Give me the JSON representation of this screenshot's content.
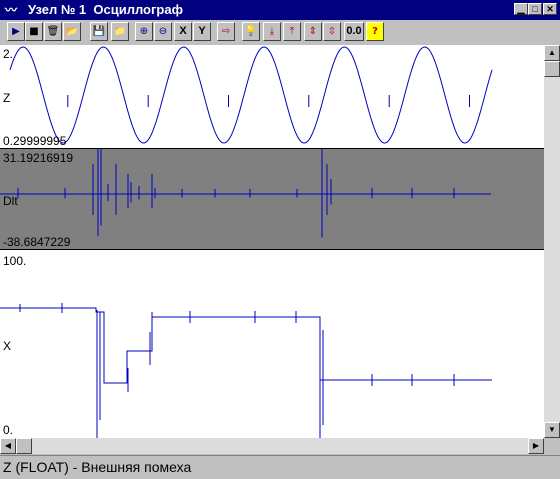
{
  "window": {
    "title": "Узел № 1  Осциллограф",
    "system_icon": "oscilloscope-icon",
    "controls": [
      "minimize-icon",
      "maximize-icon",
      "close-icon"
    ],
    "control_glyphs": [
      "▁",
      "□",
      "✕"
    ]
  },
  "toolbar": {
    "buttons": [
      {
        "name": "play-button",
        "icon": "play-icon",
        "glyph": "▶"
      },
      {
        "name": "stop-button",
        "icon": "stop-icon",
        "glyph": "■"
      },
      {
        "name": "delete-button",
        "icon": "trash-icon",
        "glyph": "🗑"
      },
      {
        "name": "open-folder-button",
        "icon": "folder-icon",
        "glyph": "📂"
      },
      {
        "name": "save-button",
        "icon": "floppy-icon",
        "glyph": "💾"
      },
      {
        "name": "open-button",
        "icon": "open-folder-icon",
        "glyph": "📁"
      },
      {
        "name": "zoom-in-button",
        "icon": "zoom-in-icon",
        "glyph": "⊕"
      },
      {
        "name": "zoom-out-button",
        "icon": "zoom-out-icon",
        "glyph": "⊖"
      },
      {
        "name": "x-axis-button",
        "icon": "x-axis-icon",
        "glyph": "X"
      },
      {
        "name": "y-axis-button",
        "icon": "y-axis-icon",
        "glyph": "Y"
      },
      {
        "name": "export-button",
        "icon": "export-icon",
        "glyph": "⇨"
      },
      {
        "name": "bulb-button",
        "icon": "bulb-icon",
        "glyph": "💡"
      },
      {
        "name": "marker-down-button",
        "icon": "marker-down-icon",
        "glyph": "⤓"
      },
      {
        "name": "marker-up-button",
        "icon": "marker-up-icon",
        "glyph": "⤒"
      },
      {
        "name": "marker-range-button",
        "icon": "marker-range-icon",
        "glyph": "⇕"
      },
      {
        "name": "marker-fit-button",
        "icon": "marker-fit-icon",
        "glyph": "⇳"
      },
      {
        "name": "zero-button",
        "icon": "zero-value-icon",
        "glyph": "0.0"
      },
      {
        "name": "help-button",
        "icon": "help-icon",
        "glyph": "?"
      }
    ]
  },
  "chart_data": [
    {
      "type": "line",
      "series": [
        {
          "name": "Z"
        }
      ],
      "ymax_label": "2.",
      "ymin_label": "0.29999995",
      "signal": "sine",
      "cycles": 6,
      "background": "#ffffff",
      "line_color": "#0000c0"
    },
    {
      "type": "line",
      "series": [
        {
          "name": "Dlt"
        }
      ],
      "ymax_label": "31.19216919",
      "ymin_label": "-38.6847229",
      "signal": "spikes",
      "background": "#808080",
      "line_color": "#0000c0"
    },
    {
      "type": "line",
      "series": [
        {
          "name": "X"
        }
      ],
      "ymax_label": "100.",
      "ymin_label": "0.",
      "signal": "step",
      "background": "#ffffff",
      "line_color": "#0000c0"
    }
  ],
  "status": {
    "text": "Z (FLOAT) - Внешняя помеха"
  },
  "scrollbar_icons": {
    "up": "▲",
    "down": "▼",
    "left": "◀",
    "right": "▶"
  }
}
